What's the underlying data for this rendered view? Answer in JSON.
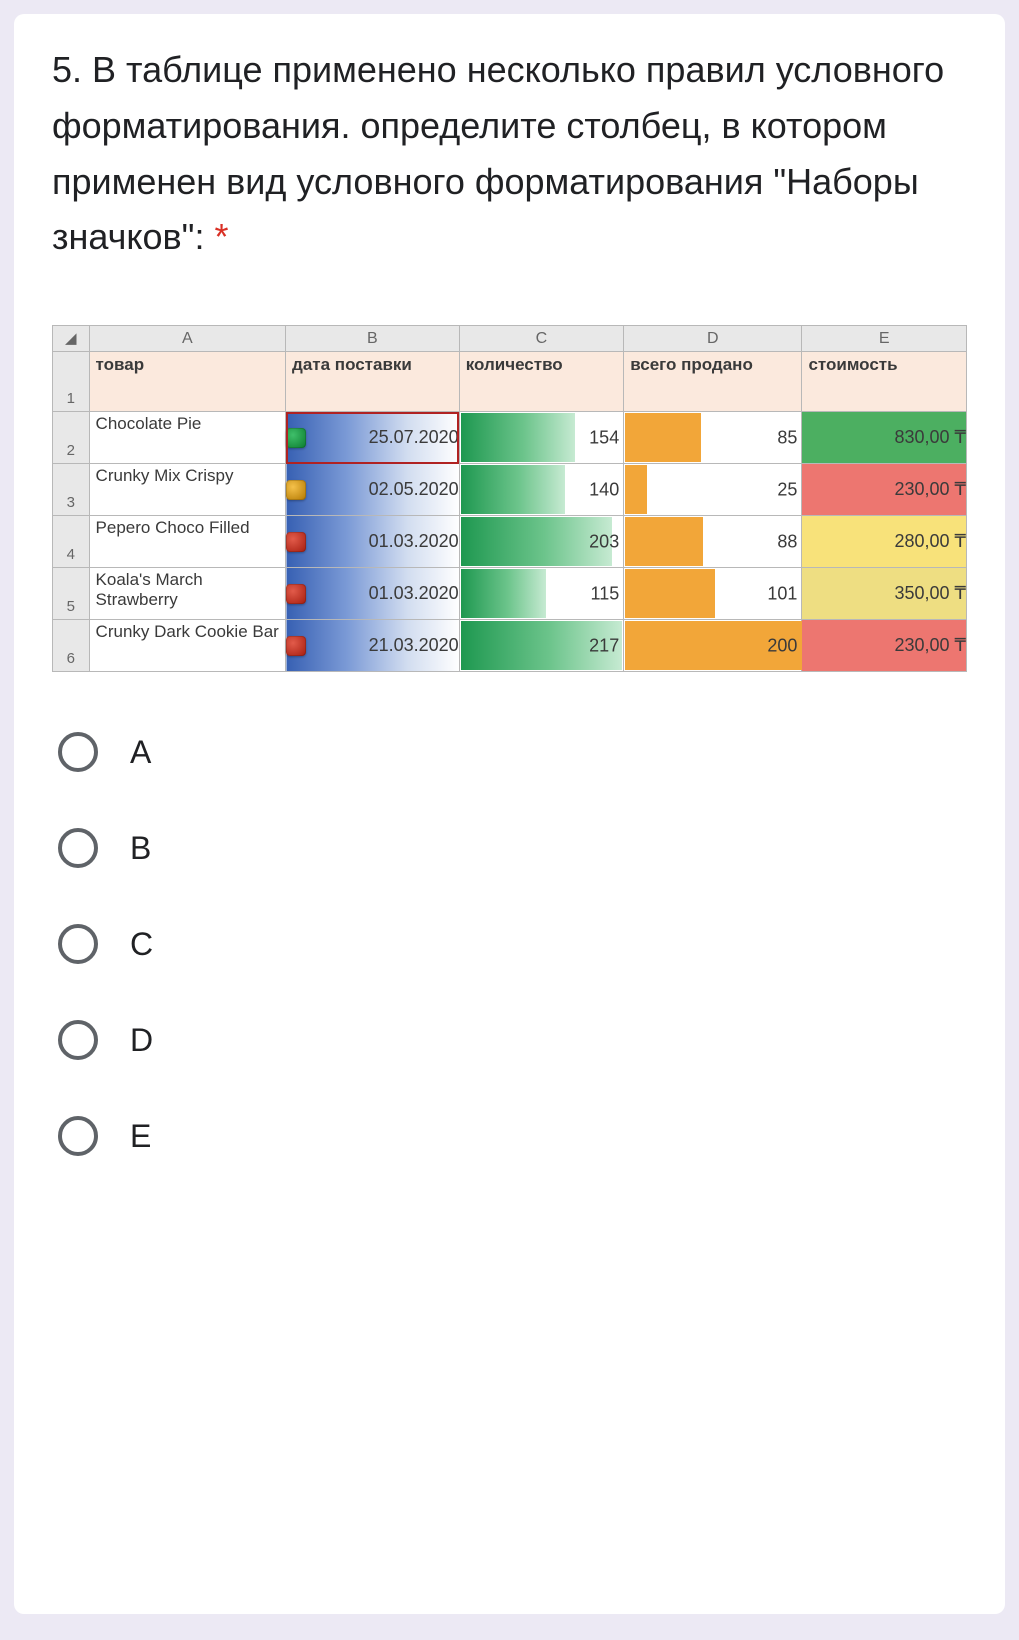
{
  "question": {
    "number_prefix": "5. ",
    "text": "В таблице применено несколько правил условного форматирования. определите столбец, в котором применен вид условного форматирования \"Наборы значков\":",
    "required_mark": "*"
  },
  "sheet": {
    "col_letters": [
      "A",
      "B",
      "C",
      "D",
      "E"
    ],
    "headers": {
      "a": "товар",
      "b": "дата поставки",
      "c": "количество",
      "d": "всего продано",
      "e": "стоимость"
    },
    "row_nums": [
      "1",
      "2",
      "3",
      "4",
      "5",
      "6"
    ],
    "rows": [
      {
        "product": "Chocolate Pie",
        "icon": "green",
        "date": "25.07.2020",
        "qty": "154",
        "sold": "85",
        "cost": "830,00 ₸",
        "cost_cls": "cs-green",
        "selected": true
      },
      {
        "product": "Crunky Mix Crispy",
        "icon": "yellow",
        "date": "02.05.2020",
        "qty": "140",
        "sold": "25",
        "cost": "230,00 ₸",
        "cost_cls": "cs-red"
      },
      {
        "product": "Pepero Choco Filled",
        "icon": "red",
        "date": "01.03.2020",
        "qty": "203",
        "sold": "88",
        "cost": "280,00 ₸",
        "cost_cls": "cs-yellow"
      },
      {
        "product": "Koala's March Strawberry",
        "icon": "red",
        "date": "01.03.2020",
        "qty": "115",
        "sold": "101",
        "cost": "350,00 ₸",
        "cost_cls": "cs-yellow2"
      },
      {
        "product": "Crunky Dark Cookie Bar",
        "icon": "red",
        "date": "21.03.2020",
        "qty": "217",
        "sold": "200",
        "cost": "230,00 ₸",
        "cost_cls": "cs-red"
      }
    ]
  },
  "chart_data": {
    "type": "table",
    "note": "Embedded spreadsheet screenshot with Excel conditional formatting. Column B uses Icon Sets (traffic-light squares), Column C uses green gradient Data Bars, Column D uses solid orange Data Bars, Column E uses a Color Scale.",
    "columns": [
      "товар",
      "дата поставки",
      "количество",
      "всего продано",
      "стоимость (₸)"
    ],
    "rows": [
      [
        "Chocolate Pie",
        "25.07.2020",
        154,
        85,
        830.0
      ],
      [
        "Crunky Mix Crispy",
        "02.05.2020",
        140,
        25,
        230.0
      ],
      [
        "Pepero Choco Filled",
        "01.03.2020",
        203,
        88,
        280.0
      ],
      [
        "Koala's March Strawberry",
        "01.03.2020",
        115,
        101,
        350.0
      ],
      [
        "Crunky Dark Cookie Bar",
        "21.03.2020",
        217,
        200,
        230.0
      ]
    ],
    "qty_range": [
      0,
      220
    ],
    "sold_range": [
      0,
      200
    ]
  },
  "options": [
    {
      "label": "A"
    },
    {
      "label": "B"
    },
    {
      "label": "C"
    },
    {
      "label": "D"
    },
    {
      "label": "E"
    }
  ]
}
